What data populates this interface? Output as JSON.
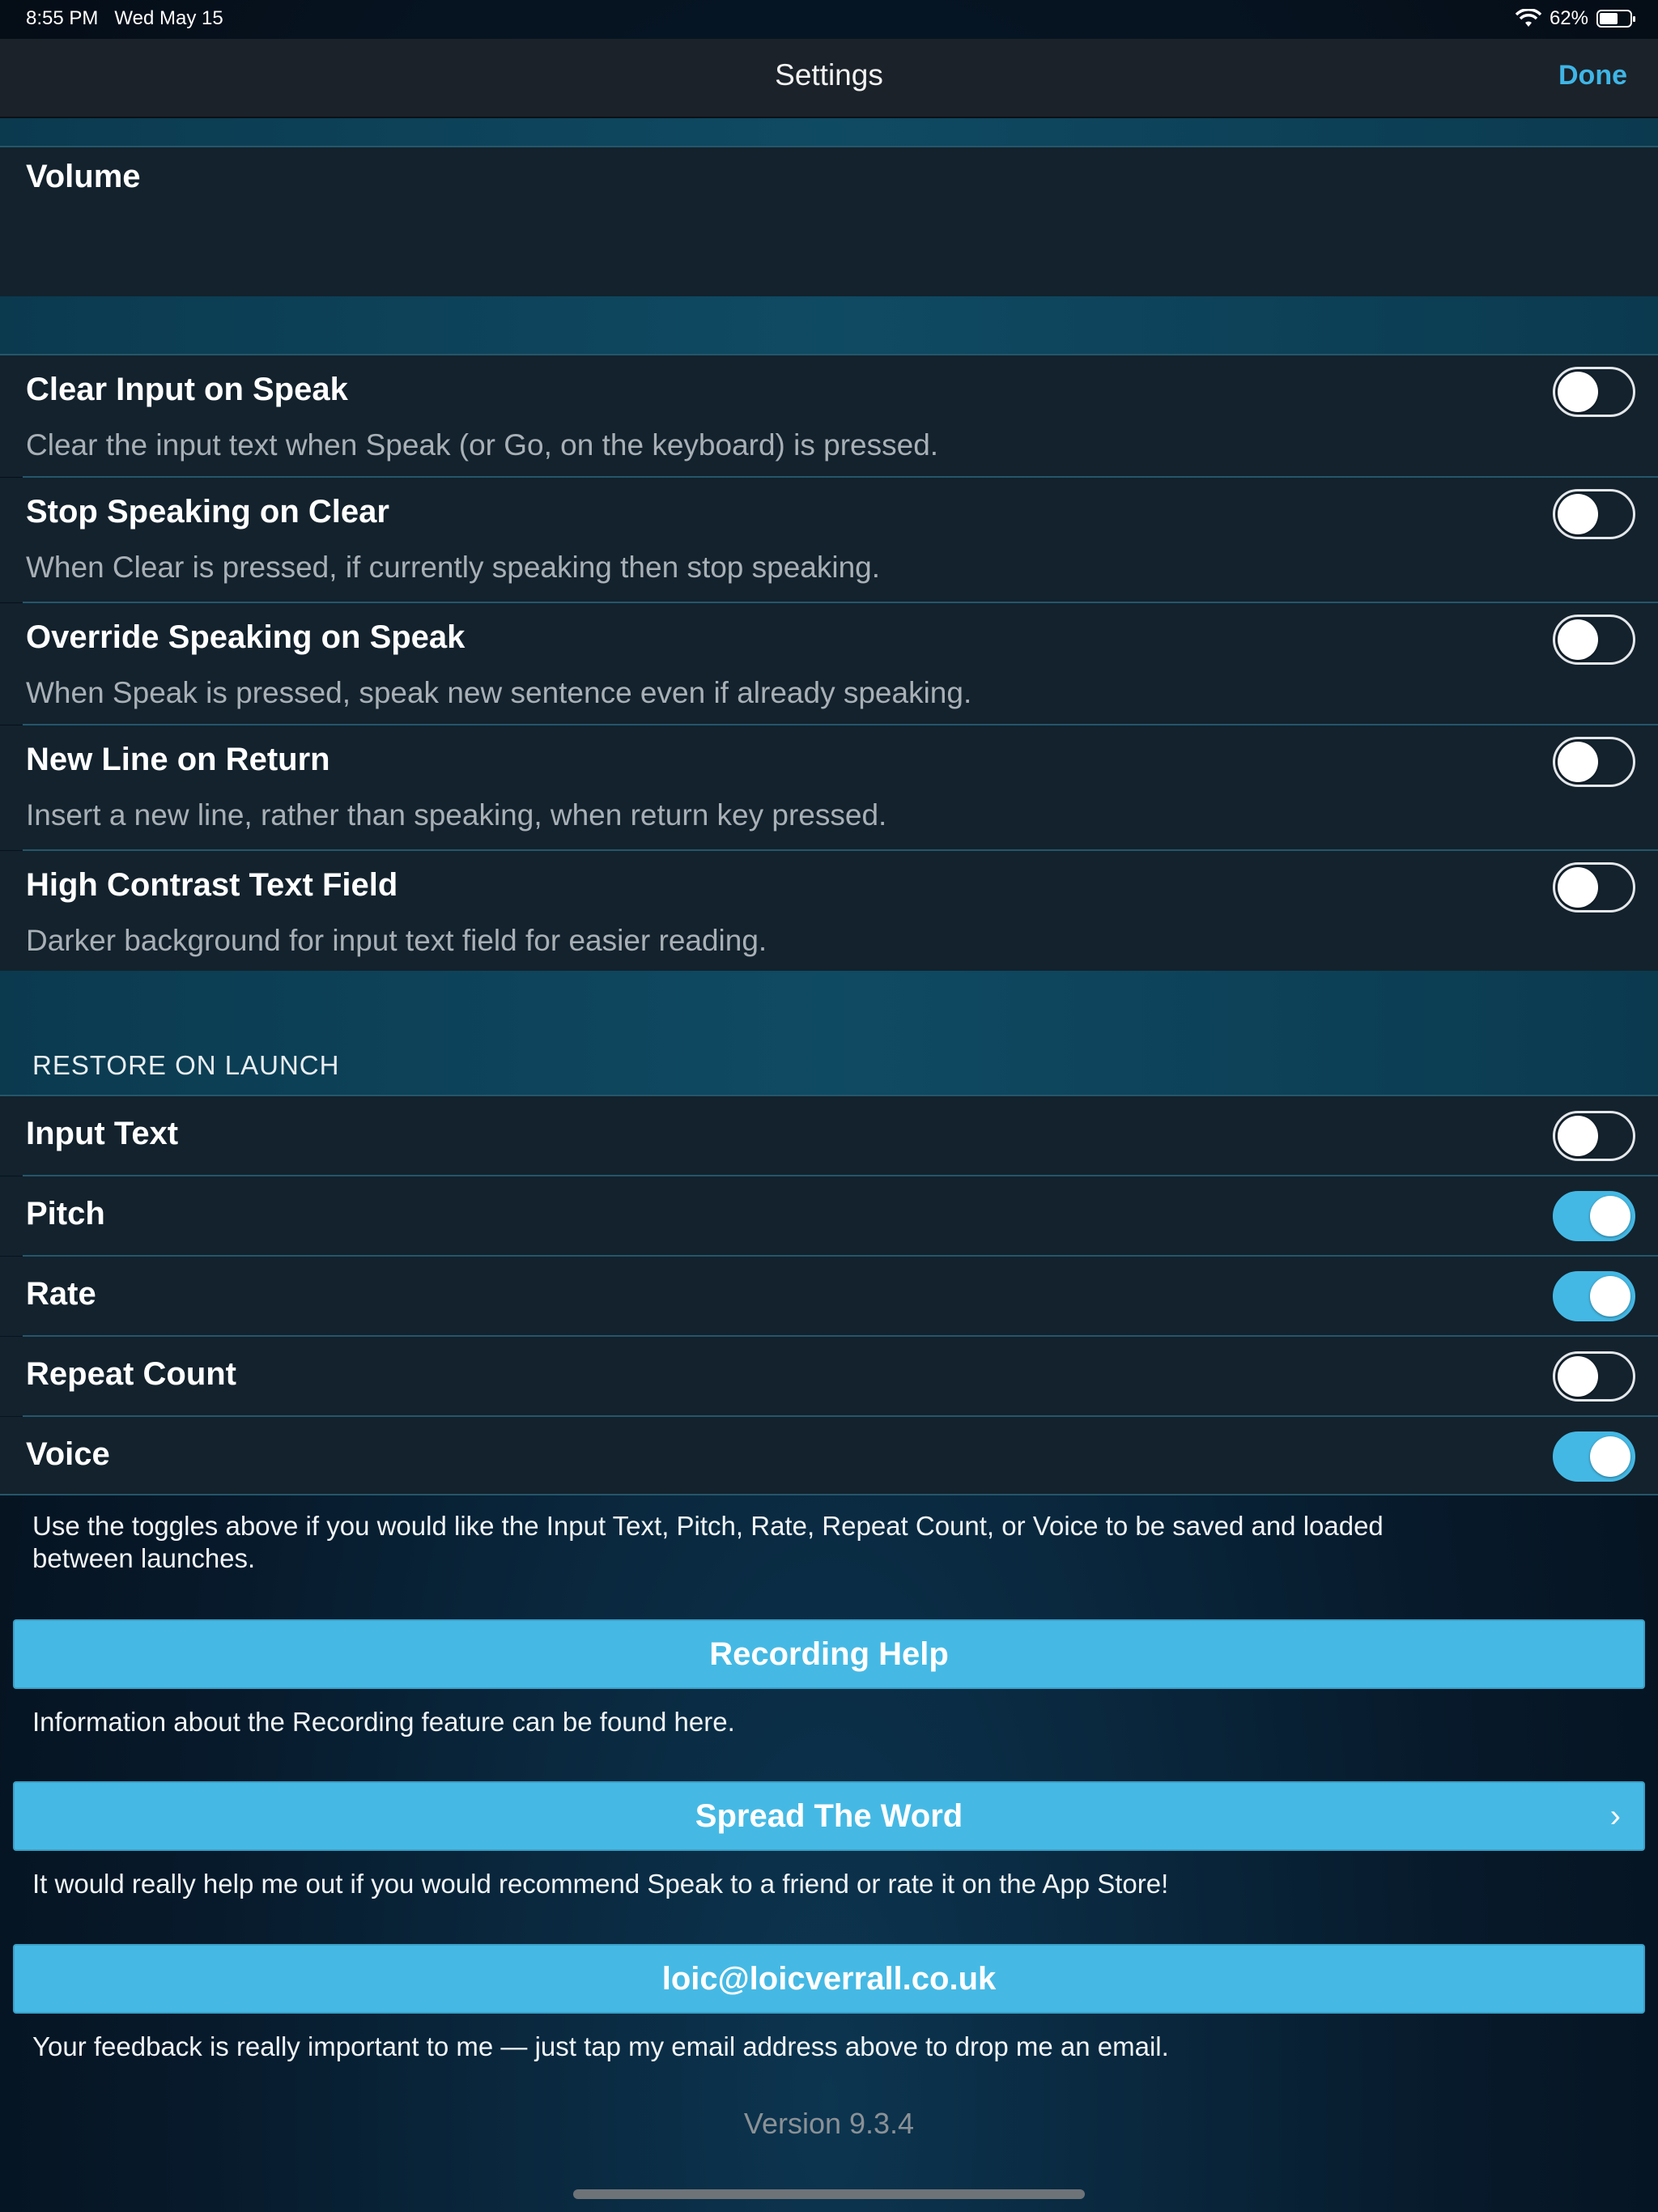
{
  "status_bar": {
    "time": "8:55 PM",
    "date": "Wed May 15",
    "battery": "62%",
    "battery_level": 0.62
  },
  "nav": {
    "title": "Settings",
    "done": "Done"
  },
  "volume_row": {
    "label": "Volume"
  },
  "options": [
    {
      "label": "Clear Input on Speak",
      "description": "Clear the input text when Speak (or Go, on the keyboard) is pressed.",
      "on": false
    },
    {
      "label": "Stop Speaking on Clear",
      "description": "When Clear is pressed, if currently speaking then stop speaking.",
      "on": false
    },
    {
      "label": "Override Speaking on Speak",
      "description": "When Speak is pressed, speak new sentence even if already speaking.",
      "on": false
    },
    {
      "label": "New Line on Return",
      "description": "Insert a new line, rather than speaking, when return key pressed.",
      "on": false
    },
    {
      "label": "High Contrast Text Field",
      "description": "Darker background for input text field for easier reading.",
      "on": false
    }
  ],
  "restore": {
    "header": "RESTORE ON LAUNCH",
    "items": [
      {
        "label": "Input Text",
        "on": false
      },
      {
        "label": "Pitch",
        "on": true
      },
      {
        "label": "Rate",
        "on": true
      },
      {
        "label": "Repeat Count",
        "on": false
      },
      {
        "label": "Voice",
        "on": true
      }
    ],
    "footer": "Use the toggles above if you would like the Input Text, Pitch, Rate, Repeat Count, or Voice to be saved and loaded between launches."
  },
  "buttons": {
    "recording_help": "Recording Help",
    "recording_help_note": "Information about the Recording feature can be found here.",
    "spread_word": "Spread The Word",
    "spread_word_chevron": "›",
    "spread_word_note": "It would really help me out if you would recommend Speak to a friend or rate it on the App Store!",
    "email": "loic@loicverrall.co.uk",
    "email_note": "Your feedback is really important to me — just tap my email address above to drop me an email."
  },
  "version": "Version 9.3.4",
  "colors": {
    "accent": "#44b8e4",
    "link": "#3fb5e6"
  }
}
